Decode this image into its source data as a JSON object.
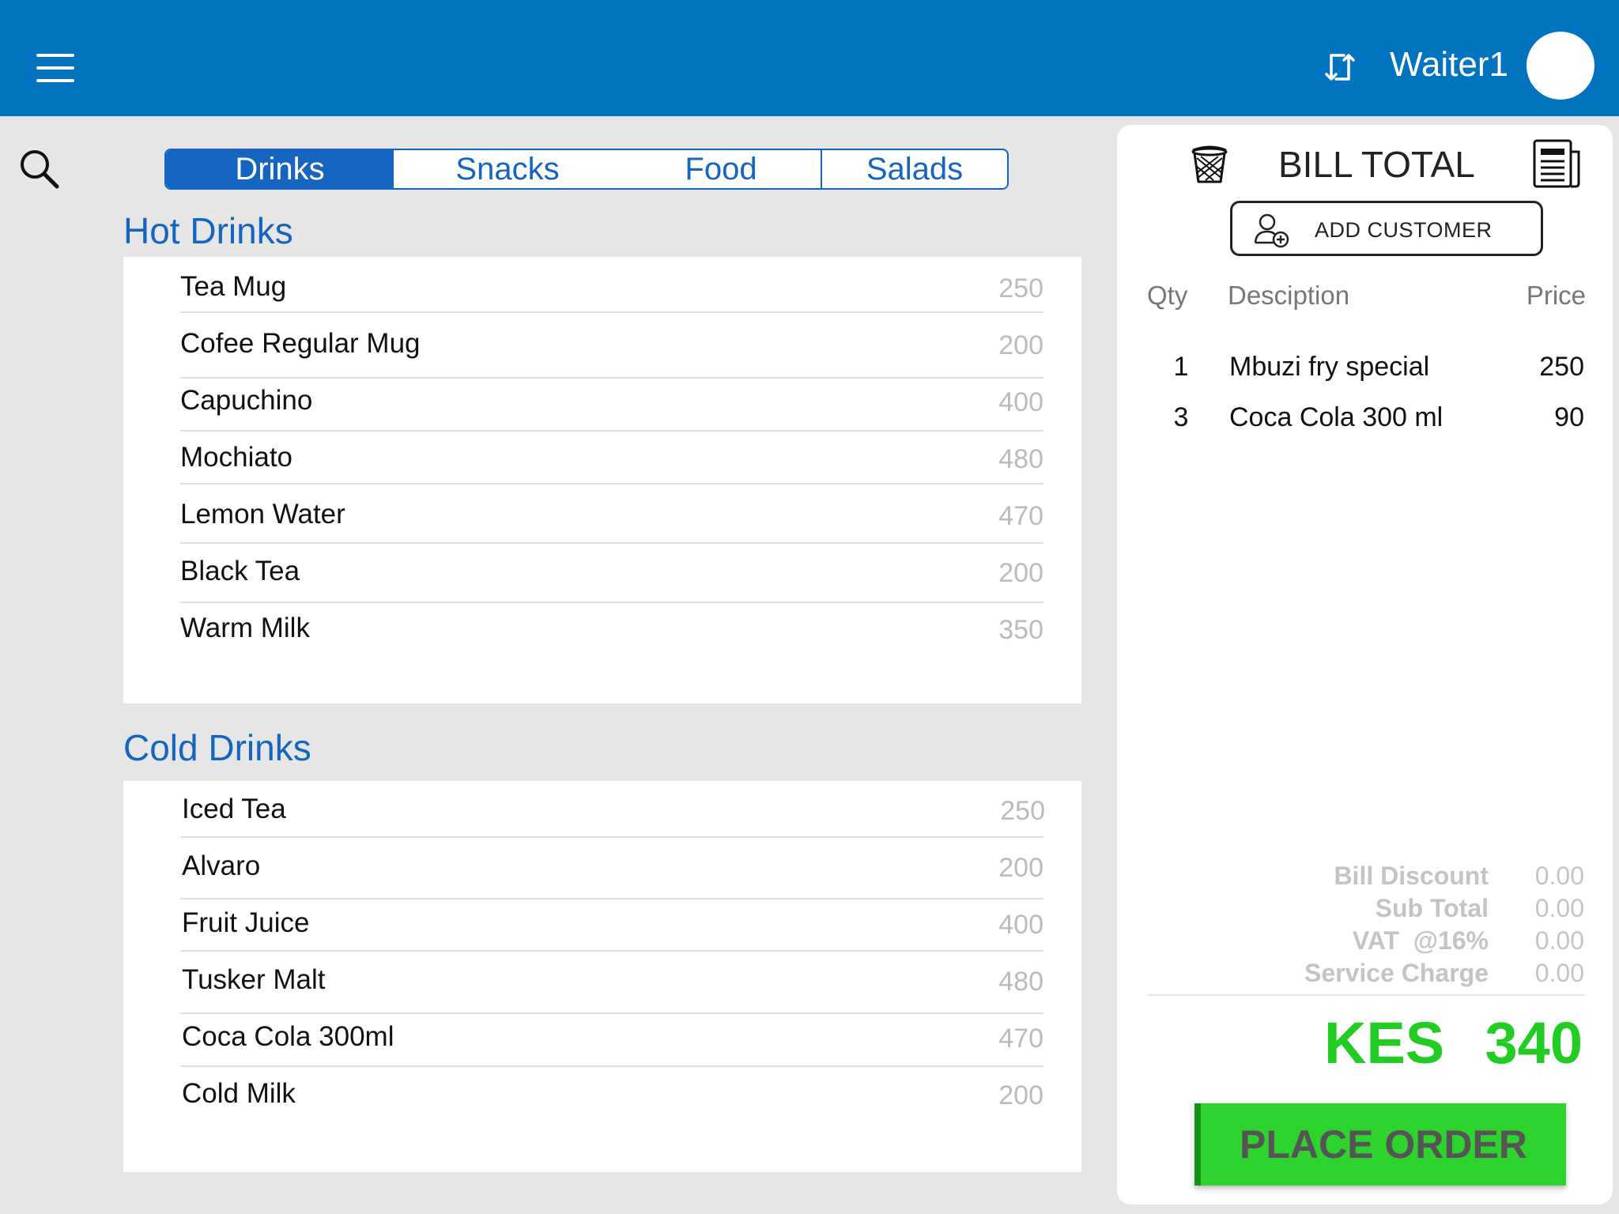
{
  "header": {
    "user_name": "Waiter1"
  },
  "tabs": [
    "Drinks",
    "Snacks",
    "Food",
    "Salads"
  ],
  "sections": [
    {
      "title": "Hot Drinks",
      "items": [
        {
          "name": "Tea Mug",
          "price": "250"
        },
        {
          "name": "Cofee Regular Mug",
          "price": "200"
        },
        {
          "name": "Capuchino",
          "price": "400"
        },
        {
          "name": "Mochiato",
          "price": "480"
        },
        {
          "name": "Lemon Water",
          "price": "470"
        },
        {
          "name": "Black Tea",
          "price": "200"
        },
        {
          "name": "Warm Milk",
          "price": "350"
        }
      ]
    },
    {
      "title": "Cold Drinks",
      "items": [
        {
          "name": "Iced Tea",
          "price": "250"
        },
        {
          "name": "Alvaro",
          "price": "200"
        },
        {
          "name": "Fruit Juice",
          "price": "400"
        },
        {
          "name": "Tusker Malt",
          "price": "480"
        },
        {
          "name": "Coca Cola 300ml",
          "price": "470"
        },
        {
          "name": "Cold Milk",
          "price": "200"
        }
      ]
    }
  ],
  "bill": {
    "title": "BILL TOTAL",
    "add_customer_label": "ADD CUSTOMER",
    "columns": {
      "qty": "Qty",
      "description": "Desciption",
      "price": "Price"
    },
    "lines": [
      {
        "qty": "1",
        "description": "Mbuzi fry special",
        "price": "250"
      },
      {
        "qty": "3",
        "description": "Coca Cola 300 ml",
        "price": "90"
      }
    ],
    "summary": [
      {
        "label": "Bill Discount",
        "value": "0.00"
      },
      {
        "label": "Sub Total",
        "value": "0.00"
      },
      {
        "label": "VAT  @16%",
        "value": "0.00"
      },
      {
        "label": "Service Charge",
        "value": "0.00"
      }
    ],
    "currency": "KES",
    "total": "340",
    "place_order_label": "PLACE ORDER"
  },
  "colors": {
    "header_bg": "#0173bf",
    "accent_blue": "#1565c0",
    "total_green": "#22cc22",
    "button_green": "#2ed32e"
  },
  "icons": [
    "menu-icon",
    "sync-icon",
    "avatar",
    "search-icon",
    "trash-icon",
    "receipt-icon",
    "add-user-icon"
  ]
}
